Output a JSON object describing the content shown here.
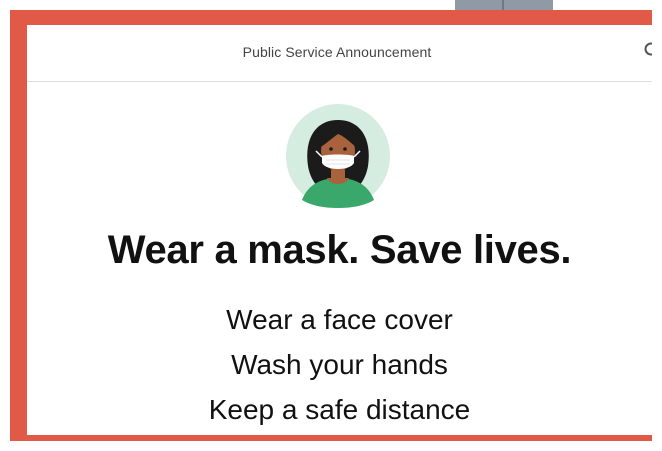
{
  "header": {
    "title": "Public Service Announcement"
  },
  "icons": {
    "search": "search-icon",
    "avatar": "masked-person-avatar"
  },
  "main": {
    "headline": "Wear a mask. Save lives.",
    "tips": [
      "Wear a face cover",
      "Wash your hands",
      "Keep a safe distance"
    ]
  },
  "colors": {
    "frame": "#e05a47",
    "avatar_background": "#d5ece0",
    "shirt": "#3aa86b",
    "hair": "#1b1b1b",
    "skin": "#a8623c",
    "mask": "#ffffff",
    "text": "#111111"
  }
}
